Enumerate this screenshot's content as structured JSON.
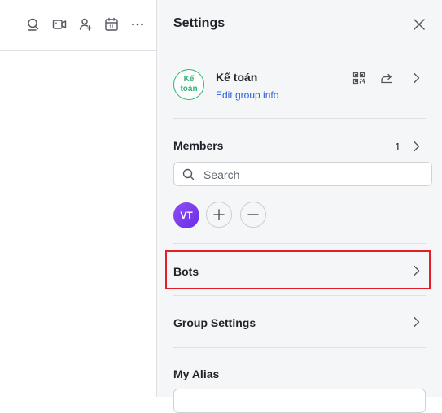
{
  "toolbar": {
    "icons": [
      "search-chat-icon",
      "video-call-icon",
      "add-member-icon",
      "calendar-icon",
      "more-icon"
    ],
    "calendar_day": "11"
  },
  "settings": {
    "title": "Settings"
  },
  "group": {
    "avatar_text": "Kế toán",
    "name": "Kế toán",
    "edit_label": "Edit group info",
    "avatar_color": "#2bb673"
  },
  "members": {
    "label": "Members",
    "count": "1",
    "search_placeholder": "Search",
    "list": [
      {
        "initials": "VT",
        "color": "#7b3ff2"
      }
    ]
  },
  "bots": {
    "label": "Bots"
  },
  "group_settings": {
    "label": "Group Settings"
  },
  "alias": {
    "label": "My Alias"
  },
  "colors": {
    "link": "#245bdb",
    "highlight": "#e41e26"
  }
}
